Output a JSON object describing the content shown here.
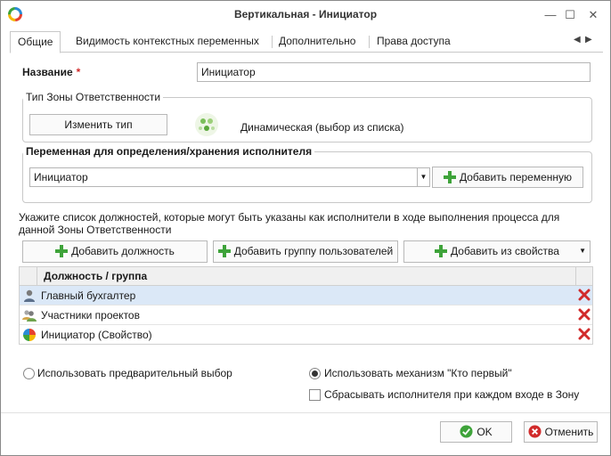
{
  "window": {
    "title": "Вертикальная - Инициатор",
    "minimize": "—",
    "maximize": "☐",
    "close": "✕"
  },
  "tabs": [
    {
      "label": "Общие"
    },
    {
      "label": "Видимость контекстных переменных"
    },
    {
      "label": "Дополнительно"
    },
    {
      "label": "Права доступа"
    }
  ],
  "tab_nav": {
    "prev": "◀",
    "next": "▶"
  },
  "name_field": {
    "label": "Название",
    "required_mark": "*",
    "value": "Инициатор"
  },
  "zone_group": {
    "title": "Тип Зоны Ответственности",
    "change_button": "Изменить тип",
    "type_text": "Динамическая (выбор из списка)"
  },
  "variable_group": {
    "title": "Переменная для определения/хранения исполнителя",
    "selected": "Инициатор",
    "add_button": "Добавить переменную"
  },
  "instruction": "Укажите список должностей, которые могут быть указаны как исполнители в ходе выполнения процесса для данной Зоны Ответственности",
  "actions": {
    "add_position": "Добавить должность",
    "add_group": "Добавить группу пользователей",
    "add_from_property": "Добавить из свойства"
  },
  "grid": {
    "column_header": "Должность / группа",
    "rows": [
      {
        "label": "Главный бухгалтер",
        "icon": "user-icon",
        "selected": true
      },
      {
        "label": "Участники проектов",
        "icon": "user-group-icon",
        "selected": false
      },
      {
        "label": "Инициатор (Свойство)",
        "icon": "property-icon",
        "selected": false
      }
    ]
  },
  "options": {
    "preselect_label": "Использовать предварительный выбор",
    "preselect_checked": false,
    "first_come_label": "Использовать механизм \"Кто первый\"",
    "first_come_checked": true,
    "reset_label": "Сбрасывать исполнителя при каждом входе в Зону",
    "reset_checked": false
  },
  "footer": {
    "ok": "OK",
    "cancel": "Отменить"
  },
  "colors": {
    "accent_green": "#3ea33a",
    "delete_red": "#d12b2b",
    "selection": "#dbe8f7"
  }
}
